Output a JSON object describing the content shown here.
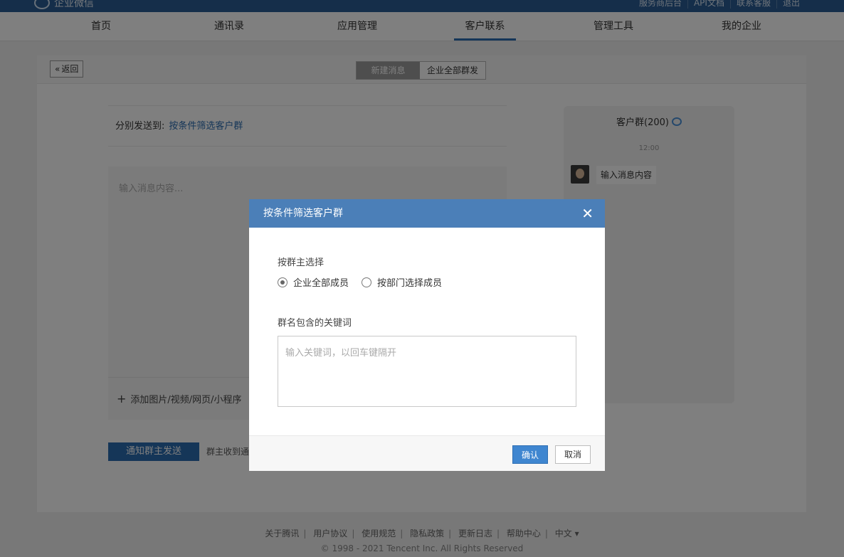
{
  "topbar": {
    "brand": "企业微信",
    "links": [
      "服务商后台",
      "API文档",
      "联系客服",
      "退出"
    ]
  },
  "nav": {
    "items": [
      "首页",
      "通讯录",
      "应用管理",
      "客户联系",
      "管理工具",
      "我的企业"
    ],
    "active": "客户联系"
  },
  "page": {
    "back_label": "返回",
    "tabs": [
      "新建消息",
      "企业全部群发"
    ],
    "send_to_label": "分别发送到:",
    "send_to_link": "按条件筛选客户群",
    "editor_placeholder": "输入消息内容...",
    "attach_label": "添加图片/视频/网页/小程序",
    "notify_button": "通知群主发送",
    "notify_tip": "群主收到通"
  },
  "preview": {
    "title": "客户群(200)",
    "time": "12:00",
    "message": "输入消息内容"
  },
  "dialog": {
    "title": "按条件筛选客户群",
    "section1_label": "按群主选择",
    "radio_all": "企业全部成员",
    "radio_dept": "按部门选择成员",
    "section2_label": "群名包含的关键词",
    "keyword_placeholder": "输入关键词，以回车键隔开",
    "confirm": "确认",
    "cancel": "取消"
  },
  "footer": {
    "links": [
      "关于腾讯",
      "用户协议",
      "使用规范",
      "隐私政策",
      "更新日志",
      "帮助中心",
      "中文 ▾"
    ],
    "copyright": "© 1998 - 2021 Tencent Inc. All Rights Reserved"
  },
  "colors": {
    "brand_bar": "#2b5d94",
    "accent": "#2b6cb0",
    "dialog_header": "#4b7fb8"
  }
}
